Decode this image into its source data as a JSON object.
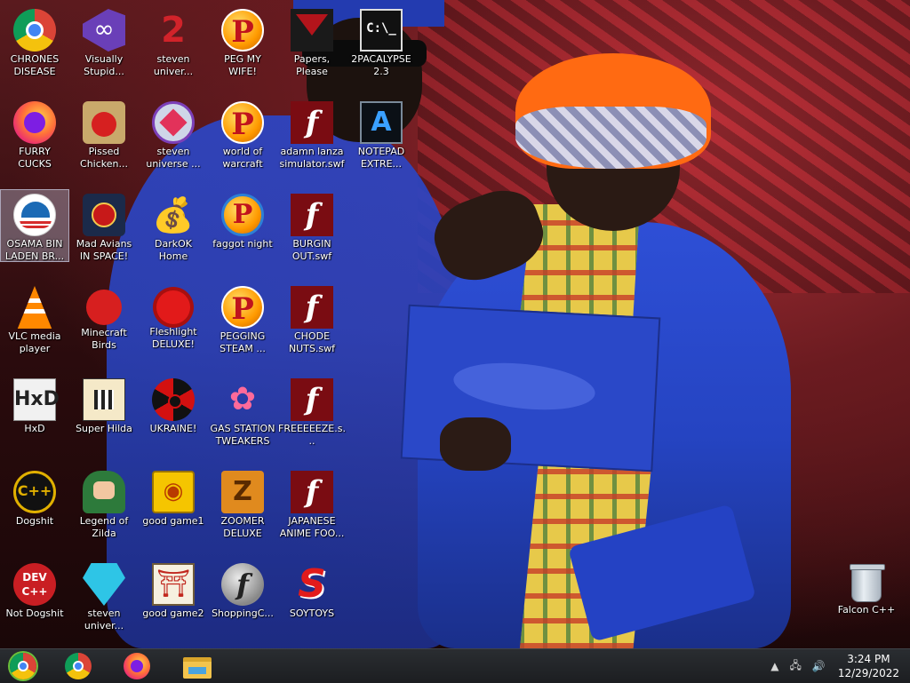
{
  "desktop": {
    "icons": [
      {
        "label": "CHRONES DISEASE",
        "icon": "chrome-icon"
      },
      {
        "label": "Visually Stupid...",
        "icon": "visual-studio-icon"
      },
      {
        "label": "steven univer...",
        "icon": "steven-universe-2-icon"
      },
      {
        "label": "PEG MY WIFE!",
        "icon": "pegging-p-icon"
      },
      {
        "label": "Papers, Please",
        "icon": "papers-please-icon"
      },
      {
        "label": "2PACALYPSE 2.3",
        "icon": "command-prompt-icon"
      },
      {
        "label": "FURRY CUCKS",
        "icon": "firefox-icon"
      },
      {
        "label": "Pissed Chicken...",
        "icon": "angry-birds-seasons-icon"
      },
      {
        "label": "steven universe ...",
        "icon": "gem-icon"
      },
      {
        "label": "world of warcraft",
        "icon": "pegging-p-icon"
      },
      {
        "label": "adamn lanza simulator.swf",
        "icon": "flash-icon"
      },
      {
        "label": "NOTEPAD EXTRE...",
        "icon": "notepad-extreme-icon"
      },
      {
        "label": "OSAMA BIN LADEN BR...",
        "icon": "obama-logo-icon"
      },
      {
        "label": "Mad Avians IN SPACE!",
        "icon": "angry-birds-space-icon"
      },
      {
        "label": "DarkOK Home",
        "icon": "money-bag-icon"
      },
      {
        "label": "faggot night",
        "icon": "pegging-p-blue-icon"
      },
      {
        "label": "BURGIN OUT.swf",
        "icon": "flash-icon"
      },
      {
        "label": "VLC media player",
        "icon": "vlc-cone-icon"
      },
      {
        "label": "Minecraft Birds",
        "icon": "red-bird-icon"
      },
      {
        "label": "Fleshlight DELUXE!",
        "icon": "red-fuzzy-icon"
      },
      {
        "label": "PEGGING STEAM ...",
        "icon": "pegging-p-icon"
      },
      {
        "label": "CHODE NUTS.swf",
        "icon": "flash-icon"
      },
      {
        "label": "HxD",
        "icon": "hxd-icon"
      },
      {
        "label": "Super Hilda",
        "icon": "pixel-cat-icon"
      },
      {
        "label": "UKRAINE!",
        "icon": "radiation-icon"
      },
      {
        "label": "GAS STATION TWEAKERS",
        "icon": "plants-icon"
      },
      {
        "label": "FREEEEEZE.s...",
        "icon": "flash-icon"
      },
      {
        "label": "Dogshit",
        "icon": "dogshit-cpp-icon"
      },
      {
        "label": "Legend of Zilda",
        "icon": "zilda-character-icon"
      },
      {
        "label": "good game1",
        "icon": "mahjong-tile-icon"
      },
      {
        "label": "ZOOMER DELUXE",
        "icon": "zoomer-z-icon"
      },
      {
        "label": "JAPANESE ANIME FOO...",
        "icon": "flash-icon"
      },
      {
        "label": "Not Dogshit",
        "icon": "dev-cpp-icon"
      },
      {
        "label": "steven univer...",
        "icon": "blue-diamond-icon"
      },
      {
        "label": "good game2",
        "icon": "torii-tile-icon"
      },
      {
        "label": "ShoppingC...",
        "icon": "flash-player-icon"
      },
      {
        "label": "SOYTOYS",
        "icon": "red-s-icon"
      },
      {
        "label": "Falcon C++",
        "icon": "recycle-bin-icon"
      }
    ],
    "glyphs": {
      "cmd": "C:\\_",
      "p": "P",
      "flash": "f",
      "notepad": "A",
      "bag": "💰",
      "hxd": "HxD",
      "plant": "✿",
      "dogshit": "C++",
      "mahjong": "◉",
      "zoomer": "Z",
      "dev_line1": "DEV",
      "dev_line2": "C++",
      "torii": "⛩",
      "shopping": "f",
      "soytoys": "S",
      "su2": "2"
    }
  },
  "taskbar": {
    "pinned": [
      "start-button",
      "chrome",
      "firefox",
      "file-explorer"
    ],
    "tray": {
      "chevron": "▲",
      "network": "🖧",
      "volume": "🔊"
    },
    "clock": {
      "time": "3:24 PM",
      "date": "12/29/2022"
    }
  },
  "colors": {
    "taskbar": "#1c1e21",
    "selection": "#c8d7f0",
    "label_text": "#ffffff"
  }
}
